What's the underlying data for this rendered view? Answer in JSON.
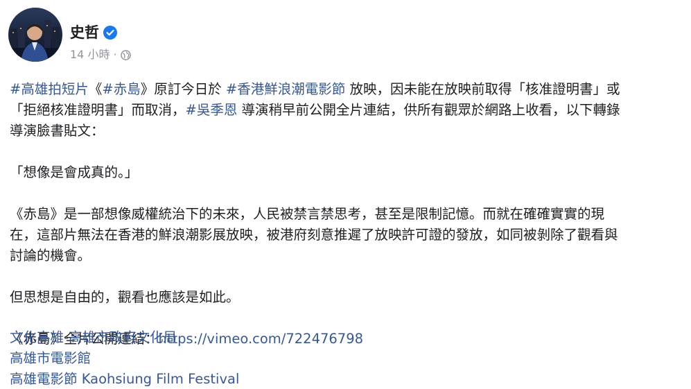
{
  "author": {
    "name": "史哲",
    "time": "14 小時",
    "dot": "·",
    "verified_icon": "verified-badge-icon",
    "privacy_icon": "globe-icon",
    "accent": "#1877f2"
  },
  "post": {
    "p1": {
      "l1": {
        "t1": "#高雄拍短片",
        "s1": "《",
        "t2": "#赤島",
        "s2": "》原訂今日於 ",
        "t3": "#香港鮮浪潮電影節",
        "s3": " 放映，因未能在放映前取得「核准證明書」或"
      },
      "l2": {
        "s1": "「拒絕核准證明書」而取消，",
        "t1": "#吳季恩",
        "s2": " 導演稍早前公開全片連結，供所有觀眾於網路上收看，以下轉錄"
      },
      "l3": "導演臉書貼文："
    },
    "p2": "「想像是會成真的。」",
    "p3": {
      "l1": "《赤島》是一部想像威權統治下的未來，人民被禁言禁思考，甚至是限制記憶。而就在確確實實的現",
      "l2": "在，這部片無法在香港的鮮浪潮影展放映，被港府刻意推遲了放映許可證的發放，如同被剝除了觀看與",
      "l3": "討論的機會。"
    },
    "p4": "但思想是自由的，觀看也應該是如此。",
    "p5": {
      "prefix": "《赤島》全片公開連結：",
      "url": "https://vimeo.com/722476798"
    },
    "mentions": [
      "文化高雄-高雄市政府文化局",
      "高雄市電影館",
      "高雄電影節 Kaohsiung Film Festival"
    ]
  },
  "colors": {
    "link": "#365899",
    "text": "#1c1e21",
    "meta": "#90949c"
  }
}
